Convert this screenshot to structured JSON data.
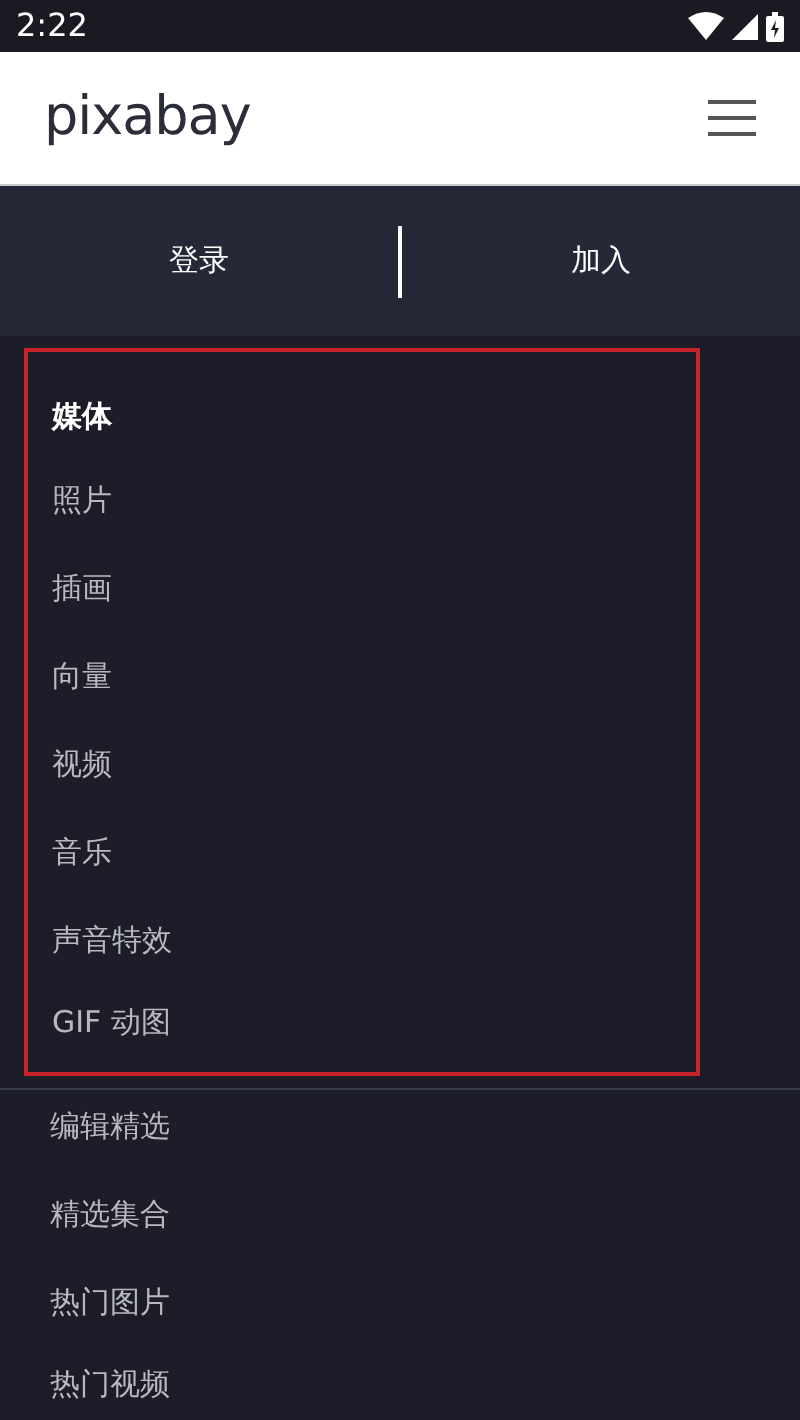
{
  "status_bar": {
    "time": "2:22"
  },
  "header": {
    "logo": "pixabay"
  },
  "auth": {
    "buttons": [
      "登录",
      "加入"
    ]
  },
  "media_menu": {
    "title": "媒体",
    "highlighted": true,
    "items": [
      "照片",
      "插画",
      "向量",
      "视频",
      "音乐",
      "声音特效",
      "GIF 动图"
    ]
  },
  "more_menu": {
    "items": [
      "编辑精选",
      "精选集合",
      "热门图片",
      "热门视频"
    ]
  }
}
